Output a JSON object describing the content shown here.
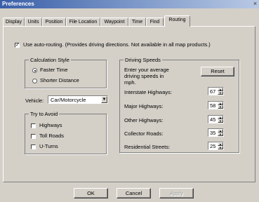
{
  "window": {
    "title": "Preferences",
    "close_glyph": "×"
  },
  "tabs": [
    {
      "label": "Display"
    },
    {
      "label": "Units"
    },
    {
      "label": "Position"
    },
    {
      "label": "File Location"
    },
    {
      "label": "Waypoint"
    },
    {
      "label": "Time"
    },
    {
      "label": "Find"
    },
    {
      "label": "Routing"
    }
  ],
  "active_tab": "Routing",
  "auto_routing": {
    "checked": true,
    "label": "Use auto-routing. (Provides driving directions. Not available in all map products.)"
  },
  "calculation_style": {
    "title": "Calculation Style",
    "options": [
      {
        "label": "Faster Time",
        "selected": true
      },
      {
        "label": "Shorter Distance",
        "selected": false
      }
    ]
  },
  "vehicle": {
    "label": "Vehicle:",
    "value": "Car/Motorcycle"
  },
  "try_to_avoid": {
    "title": "Try to Avoid",
    "options": [
      {
        "label": "Highways",
        "checked": false
      },
      {
        "label": "Toll Roads",
        "checked": false
      },
      {
        "label": "U-Turns",
        "checked": false
      }
    ]
  },
  "driving_speeds": {
    "title": "Driving Speeds",
    "instruction": "Enter your average driving speeds in mph.",
    "reset_label": "Reset",
    "rows": [
      {
        "label": "Interstate Highways:",
        "value": "67"
      },
      {
        "label": "Major Highways:",
        "value": "58"
      },
      {
        "label": "Other Highways:",
        "value": "45"
      },
      {
        "label": "Collector Roads:",
        "value": "35"
      },
      {
        "label": "Residential Streets:",
        "value": "25"
      }
    ]
  },
  "buttons": {
    "ok": "OK",
    "cancel": "Cancel",
    "apply": "Apply"
  },
  "glyphs": {
    "check": "✓",
    "dropdown": "▼",
    "up": "▲",
    "down": "▼"
  }
}
